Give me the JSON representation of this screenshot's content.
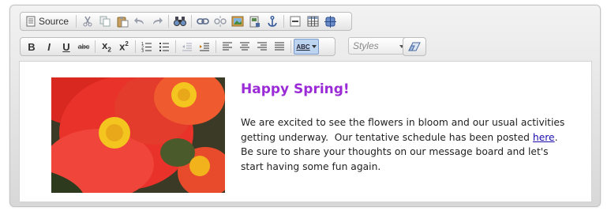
{
  "toolbar": {
    "row1": {
      "source_label": "Source",
      "icons": [
        "source-document-icon",
        "cut-icon",
        "copy-icon",
        "paste-icon",
        "undo-icon",
        "redo-icon",
        "find-icon",
        "link-icon",
        "unlink-icon",
        "image-icon",
        "flash-icon",
        "anchor-icon",
        "horizontal-rule-icon",
        "table-icon",
        "special-char-icon"
      ]
    },
    "row2": {
      "bold": "B",
      "italic": "I",
      "underline": "U",
      "strike": "abc",
      "subscript": "x",
      "subscript_mark": "2",
      "superscript": "x",
      "superscript_mark": "2",
      "spellcheck_label": "ABC",
      "styles_placeholder": "Styles"
    }
  },
  "content": {
    "headline": "Happy Spring!",
    "paragraph_lines": [
      "We are excited to see the flowers in bloom and our usual activities",
      "getting underway.  Our tentative schedule has been posted ",
      "Be sure to share your thoughts on our message board and let's",
      "start having some fun again."
    ],
    "link_text": "here",
    "link_trailing": ".",
    "image_alt": "flowers"
  },
  "colors": {
    "headline": "#9b2bd6",
    "link": "#1a0dab",
    "flower_red": "#e8322a",
    "flower_center": "#f2c21a"
  }
}
